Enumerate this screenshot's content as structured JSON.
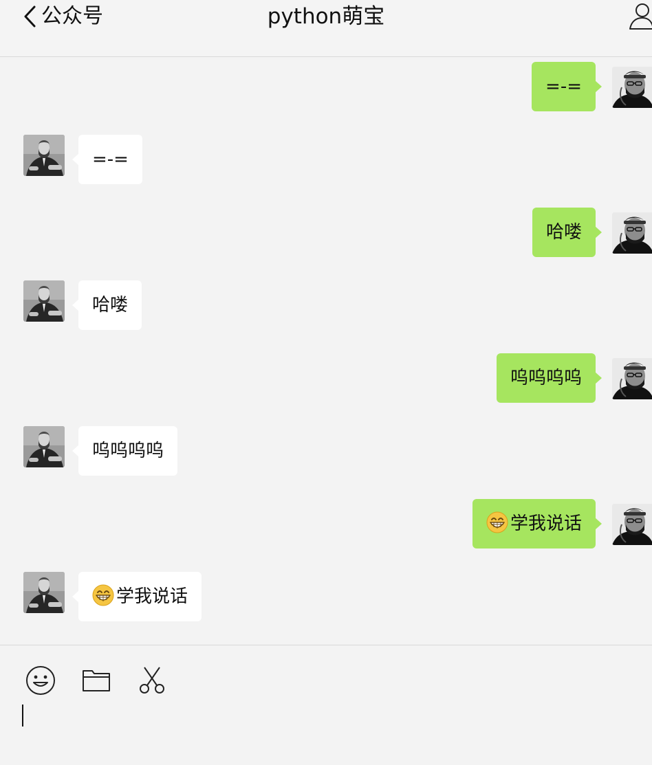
{
  "header": {
    "back_label": "公众号",
    "title": "python萌宝"
  },
  "messages": [
    {
      "side": "right",
      "text": "=-="
    },
    {
      "side": "left",
      "text": "=-="
    },
    {
      "side": "right",
      "text": "哈喽"
    },
    {
      "side": "left",
      "text": "哈喽"
    },
    {
      "side": "right",
      "text": "呜呜呜呜"
    },
    {
      "side": "left",
      "text": "呜呜呜呜"
    },
    {
      "side": "right",
      "emoji": "grinning-face-icon",
      "text": "学我说话"
    },
    {
      "side": "left",
      "emoji": "grinning-face-icon",
      "text": "学我说话"
    }
  ],
  "toolbar": {
    "icons": [
      "smiley-icon",
      "folder-icon",
      "scissors-icon"
    ]
  },
  "input": {
    "value": ""
  },
  "colors": {
    "sent_bubble": "#a6e55f",
    "received_bubble": "#ffffff",
    "background": "#f3f3f3"
  }
}
